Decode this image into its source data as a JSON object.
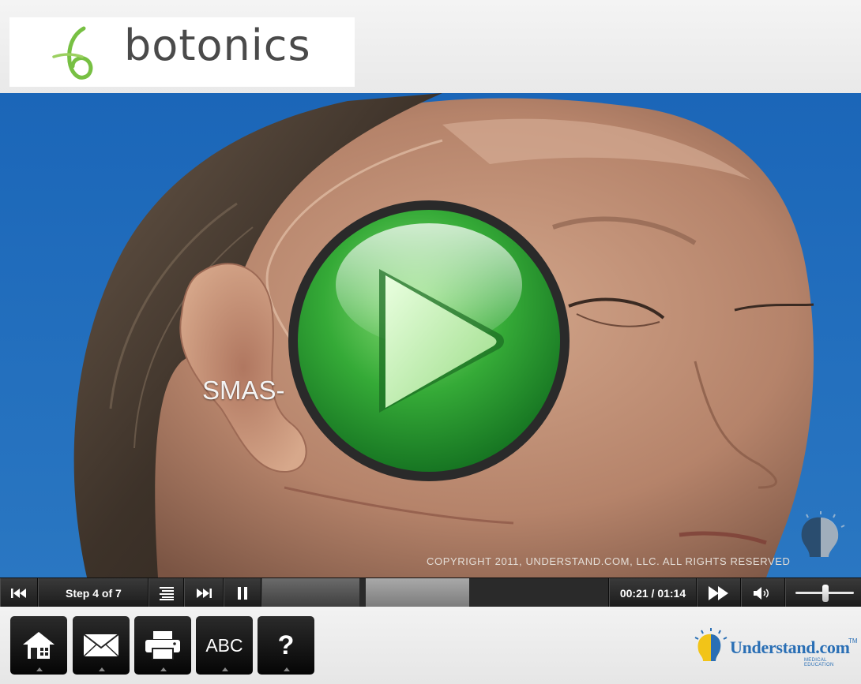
{
  "header": {
    "logo_text": "botonics"
  },
  "video": {
    "caption": "SMAS-",
    "copyright": "COPYRIGHT 2011, UNDERSTAND.COM, LLC. ALL RIGHTS RESERVED"
  },
  "controls": {
    "step_label": "Step 4 of 7",
    "time": "00:21 / 01:14",
    "progress_fraction": 0.28,
    "buffered_fraction": 0.58,
    "volume_fraction": 0.52
  },
  "toolbar": {
    "abc_label": "ABC",
    "help_label": "?"
  },
  "brand": {
    "name": "Understand.com",
    "tm": "TM",
    "sub": "MEDICAL EDUCATION"
  },
  "colors": {
    "video_background": "#1d67b4",
    "play_green": "#2fa33a",
    "brand_blue": "#2a6fb5"
  },
  "icons": [
    "rewind-icon",
    "chapters-icon",
    "skip-forward-icon",
    "pause-icon",
    "play-icon",
    "volume-icon",
    "home-icon",
    "email-icon",
    "print-icon",
    "help-icon"
  ]
}
